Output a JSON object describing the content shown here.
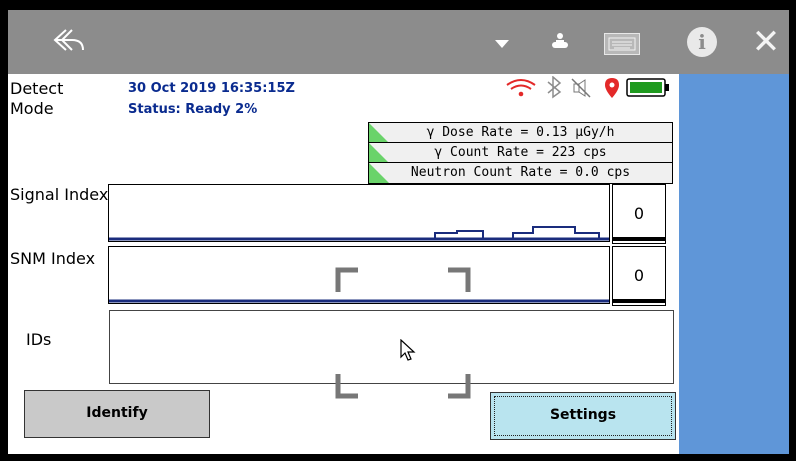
{
  "app": {
    "mode_label": "Detect Mode",
    "datetime": "30 Oct 2019 16:35:15Z",
    "status": "Status: Ready 2%"
  },
  "rates": {
    "gamma_dose": "γ Dose Rate = 0.13  μGy/h",
    "gamma_count": "γ Count Rate = 223 cps",
    "neutron_count": "Neutron Count Rate = 0.0 cps"
  },
  "panels": {
    "signal_label": "Signal Index",
    "signal_value": "0",
    "snm_label": "SNM Index",
    "snm_value": "0",
    "ids_label": "IDs"
  },
  "buttons": {
    "identify": "Identify",
    "settings": "Settings"
  },
  "battery_level": 1.0,
  "icons": {
    "back": "back-icon",
    "dropdown": "chevron-down-icon",
    "peers": "people-icon",
    "keyboard": "keyboard-icon",
    "info": "info-icon",
    "close": "close-icon",
    "wifi": "wifi-icon",
    "bluetooth": "bluetooth-icon",
    "mute": "speaker-mute-icon",
    "location": "location-pin-icon",
    "battery": "battery-icon"
  },
  "colors": {
    "topbar": "#8c8c8c",
    "sidebar": "#5f96d8",
    "status_text": "#0a2b8f",
    "rate_indicator": "#6ad36a",
    "settings_button": "#b9e4ef",
    "identify_button": "#c9c9c9"
  }
}
